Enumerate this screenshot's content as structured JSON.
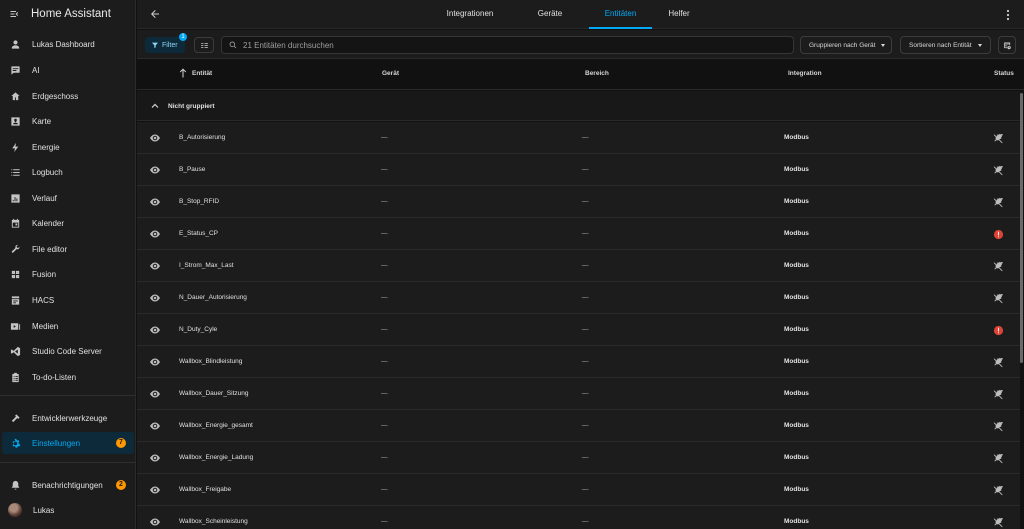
{
  "app": {
    "title": "Home Assistant"
  },
  "sidebar": {
    "items": [
      {
        "label": "Lukas Dashboard",
        "icon": "account-icon"
      },
      {
        "label": "AI",
        "icon": "chat-icon"
      },
      {
        "label": "Erdgeschoss",
        "icon": "home-icon"
      },
      {
        "label": "Karte",
        "icon": "map-icon"
      },
      {
        "label": "Energie",
        "icon": "lightning-icon"
      },
      {
        "label": "Logbuch",
        "icon": "list-icon"
      },
      {
        "label": "Verlauf",
        "icon": "chart-icon"
      },
      {
        "label": "Kalender",
        "icon": "calendar-icon"
      },
      {
        "label": "File editor",
        "icon": "wrench-icon"
      },
      {
        "label": "Fusion",
        "icon": "fusion-icon"
      },
      {
        "label": "HACS",
        "icon": "hacs-icon"
      },
      {
        "label": "Medien",
        "icon": "media-icon"
      },
      {
        "label": "Studio Code Server",
        "icon": "vscode-icon"
      },
      {
        "label": "To-do-Listen",
        "icon": "clipboard-icon"
      }
    ],
    "dev_tools": "Entwicklerwerkzeuge",
    "settings": "Einstellungen",
    "settings_badge": "7",
    "notifications": "Benachrichtigungen",
    "notifications_badge": "2",
    "user": "Lukas"
  },
  "tabs": [
    "Integrationen",
    "Geräte",
    "Entitäten",
    "Helfer"
  ],
  "active_tab": "Entitäten",
  "toolbar": {
    "filter_label": "Filter",
    "filter_count": "1",
    "search_placeholder": "21 Entitäten durchsuchen",
    "group_label": "Gruppieren nach Gerät",
    "sort_label": "Sortieren nach Entität"
  },
  "table": {
    "headers": {
      "entity": "Entität",
      "device": "Gerät",
      "area": "Bereich",
      "integration": "Integration",
      "status": "Status"
    },
    "group_label": "Nicht gruppiert",
    "rows": [
      {
        "name": "B_Autorisierung",
        "device": "—",
        "area": "—",
        "integration": "Modbus",
        "status": "unavailable"
      },
      {
        "name": "B_Pause",
        "device": "—",
        "area": "—",
        "integration": "Modbus",
        "status": "unavailable"
      },
      {
        "name": "B_Stop_RFID",
        "device": "—",
        "area": "—",
        "integration": "Modbus",
        "status": "unavailable"
      },
      {
        "name": "E_Status_CP",
        "device": "—",
        "area": "—",
        "integration": "Modbus",
        "status": "error"
      },
      {
        "name": "I_Strom_Max_Last",
        "device": "—",
        "area": "—",
        "integration": "Modbus",
        "status": "unavailable"
      },
      {
        "name": "N_Dauer_Autorisierung",
        "device": "—",
        "area": "—",
        "integration": "Modbus",
        "status": "unavailable"
      },
      {
        "name": "N_Duty_Cyle",
        "device": "—",
        "area": "—",
        "integration": "Modbus",
        "status": "error"
      },
      {
        "name": "Wallbox_Blindleistung",
        "device": "—",
        "area": "—",
        "integration": "Modbus",
        "status": "unavailable"
      },
      {
        "name": "Wallbox_Dauer_Sitzung",
        "device": "—",
        "area": "—",
        "integration": "Modbus",
        "status": "unavailable"
      },
      {
        "name": "Wallbox_Energie_gesamt",
        "device": "—",
        "area": "—",
        "integration": "Modbus",
        "status": "unavailable"
      },
      {
        "name": "Wallbox_Energie_Ladung",
        "device": "—",
        "area": "—",
        "integration": "Modbus",
        "status": "unavailable"
      },
      {
        "name": "Wallbox_Freigabe",
        "device": "—",
        "area": "—",
        "integration": "Modbus",
        "status": "unavailable"
      },
      {
        "name": "Wallbox_Scheinleistung",
        "device": "—",
        "area": "—",
        "integration": "Modbus",
        "status": "unavailable"
      }
    ]
  },
  "colors": {
    "accent": "#03a9f4",
    "badge": "#ff9800",
    "error": "#db4437"
  }
}
